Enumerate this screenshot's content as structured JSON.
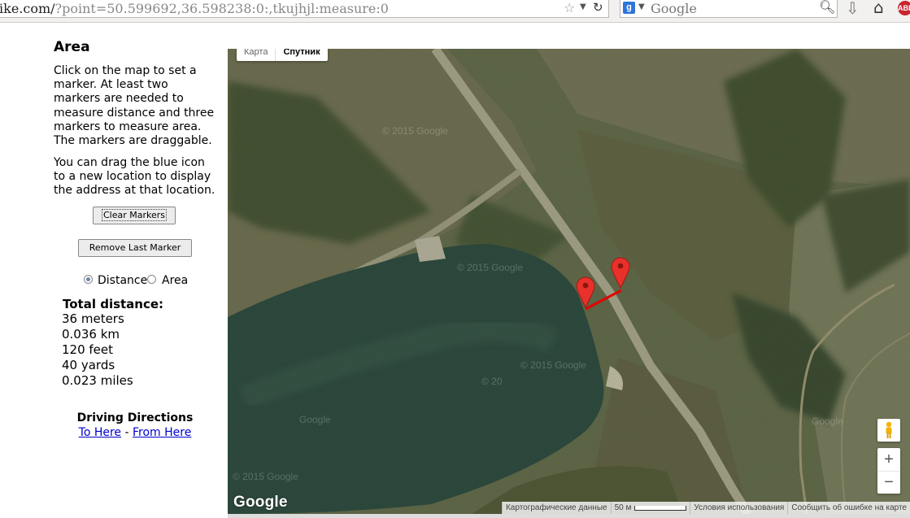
{
  "browser": {
    "url_host": "ike.com/",
    "url_path": "?point=50.599692,36.598238:0:,tkujhjl:measure:0",
    "search_engine_icon": "google-plus-icon",
    "search_engine_letter": "g",
    "search_placeholder": "Google",
    "abp_label": "ABP"
  },
  "sidebar": {
    "title": "Area",
    "instructions_1": "Click on the map to set a marker. At least two markers are needed to measure distance and three markers to measure area. The markers are draggable.",
    "instructions_2": "You can drag the blue icon to a new location to display the address at that location.",
    "clear_button": "Clear Markers",
    "remove_button": "Remove Last Marker",
    "mode_distance": "Distance",
    "mode_area": "Area",
    "selected_mode": "Distance",
    "total_heading": "Total distance:",
    "distances": [
      "36 meters",
      "0.036 km",
      "120 feet",
      "40 yards",
      "0.023 miles"
    ],
    "driving_heading": "Driving Directions",
    "to_here": "To Here",
    "link_separator": "-",
    "from_here": "From Here"
  },
  "map": {
    "type_map": "Карта",
    "type_satellite": "Спутник",
    "logo": "Google",
    "attribution_data": "Картографические данные",
    "scale_label": "50 м",
    "terms": "Условия использования",
    "report": "Сообщить об ошибке на карте",
    "zoom_in": "+",
    "zoom_out": "−",
    "watermarks": [
      "© 2015 Google",
      "© 2015 Google",
      "© 2015 Google",
      "Google",
      "© 2015 Google",
      "© 20",
      "Google"
    ],
    "marker_color": "#e8312a",
    "line_color": "#e60000"
  }
}
